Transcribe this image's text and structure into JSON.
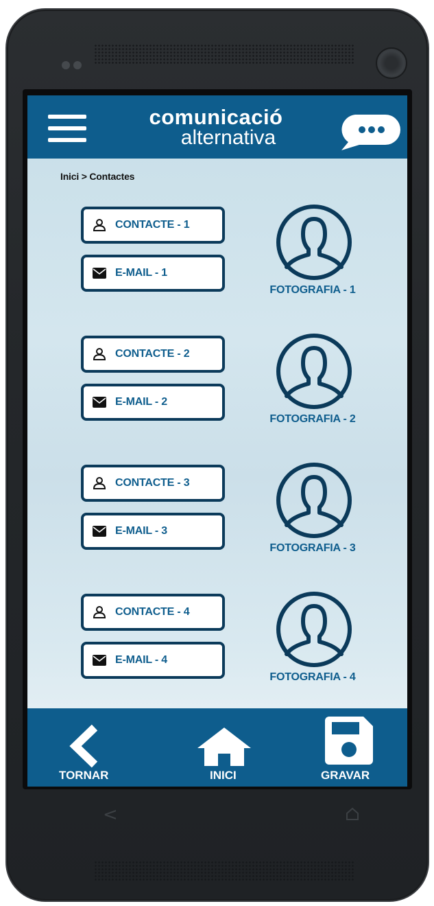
{
  "header": {
    "title_main": "comunicació",
    "title_sub": "alternativa",
    "menu_icon": "hamburger-menu-icon",
    "chat_icon": "chat-bubble-icon"
  },
  "breadcrumb": "Inici > Contactes",
  "contacts": [
    {
      "contact_label": "CONTACTE - 1",
      "email_label": "E-MAIL - 1",
      "photo_label": "FOTOGRAFIA - 1"
    },
    {
      "contact_label": "CONTACTE - 2",
      "email_label": "E-MAIL - 2",
      "photo_label": "FOTOGRAFIA - 2"
    },
    {
      "contact_label": "CONTACTE - 3",
      "email_label": "E-MAIL - 3",
      "photo_label": "FOTOGRAFIA - 3"
    },
    {
      "contact_label": "CONTACTE - 4",
      "email_label": "E-MAIL - 4",
      "photo_label": "FOTOGRAFIA - 4"
    }
  ],
  "footer": {
    "back_label": "TORNAR",
    "home_label": "INICI",
    "save_label": "GRAVAR"
  },
  "colors": {
    "brand_blue": "#0e5d8d",
    "border_navy": "#0b3a5a",
    "background_light": "#c7dee8"
  }
}
